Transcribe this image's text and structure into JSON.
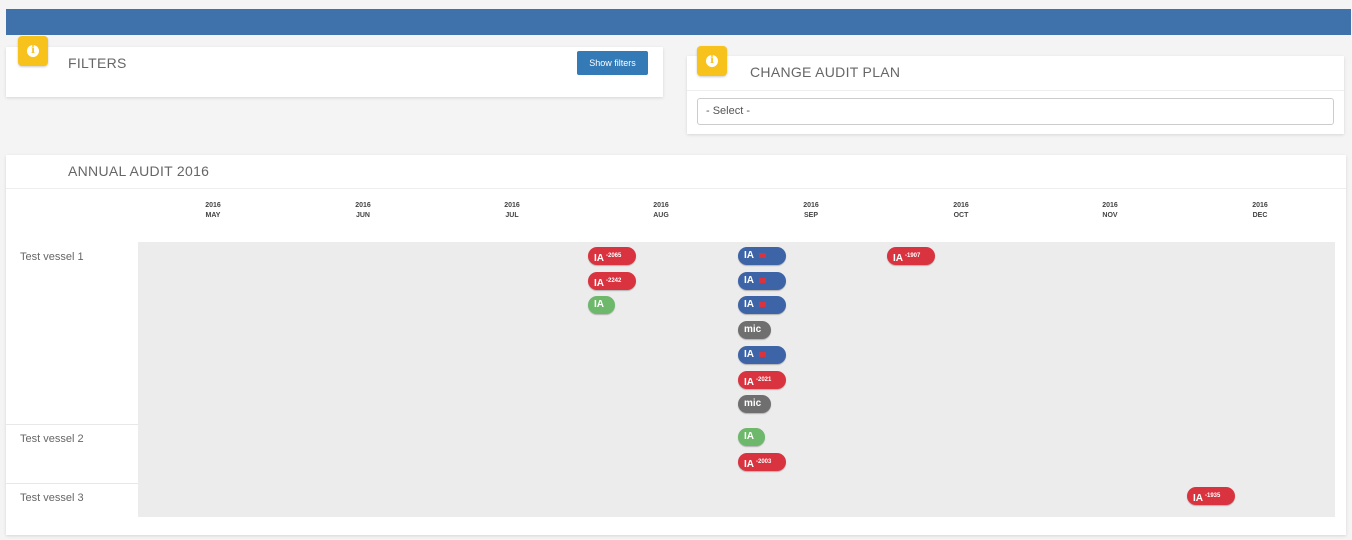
{
  "filters": {
    "title": "FILTERS",
    "show_filters_label": "Show filters"
  },
  "audit_plan": {
    "title": "CHANGE AUDIT PLAN",
    "select_value": "- Select -"
  },
  "annual": {
    "title": "ANNUAL AUDIT 2016",
    "months": [
      {
        "year": "2016",
        "month": "MAY"
      },
      {
        "year": "2016",
        "month": "JUN"
      },
      {
        "year": "2016",
        "month": "JUL"
      },
      {
        "year": "2016",
        "month": "AUG"
      },
      {
        "year": "2016",
        "month": "SEP"
      },
      {
        "year": "2016",
        "month": "OCT"
      },
      {
        "year": "2016",
        "month": "NOV"
      },
      {
        "year": "2016",
        "month": "DEC"
      }
    ],
    "vessels": [
      {
        "name": "Test vessel 1"
      },
      {
        "name": "Test vessel 2"
      },
      {
        "name": "Test vessel 3"
      }
    ],
    "events": [
      {
        "label": "IA",
        "sup": "2065",
        "color": "red",
        "vessel": 0,
        "month": "AUG"
      },
      {
        "label": "IA",
        "sup": "2242",
        "color": "red",
        "vessel": 0,
        "month": "AUG"
      },
      {
        "label": "IA",
        "sup": "",
        "color": "green",
        "vessel": 0,
        "month": "AUG"
      },
      {
        "label": "IA",
        "sup": "",
        "color": "blue",
        "flag": true,
        "vessel": 0,
        "month": "SEP"
      },
      {
        "label": "IA",
        "sup": "",
        "color": "blue",
        "flag": true,
        "vessel": 0,
        "month": "SEP"
      },
      {
        "label": "IA",
        "sup": "",
        "color": "blue",
        "flag": true,
        "vessel": 0,
        "month": "SEP"
      },
      {
        "label": "mic",
        "sup": "",
        "color": "gray",
        "vessel": 0,
        "month": "SEP"
      },
      {
        "label": "IA",
        "sup": "",
        "color": "blue",
        "flag": true,
        "vessel": 0,
        "month": "SEP"
      },
      {
        "label": "IA",
        "sup": "2021",
        "color": "red",
        "vessel": 0,
        "month": "SEP"
      },
      {
        "label": "mic",
        "sup": "",
        "color": "gray",
        "vessel": 0,
        "month": "SEP"
      },
      {
        "label": "IA",
        "sup": "1907",
        "color": "red",
        "vessel": 0,
        "month": "OCT"
      },
      {
        "label": "IA",
        "sup": "",
        "color": "green",
        "vessel": 1,
        "month": "SEP"
      },
      {
        "label": "IA",
        "sup": "2003",
        "color": "red",
        "vessel": 1,
        "month": "SEP"
      },
      {
        "label": "IA",
        "sup": "1935",
        "color": "red",
        "vessel": 2,
        "month": "DEC"
      }
    ]
  },
  "colors": {
    "topbar": "#3f72ab",
    "badge": "#f7c21b",
    "red": "#d9333f",
    "blue": "#3d64a6",
    "green": "#6db86b",
    "gray": "#6f6f6f",
    "button": "#337ab7"
  }
}
